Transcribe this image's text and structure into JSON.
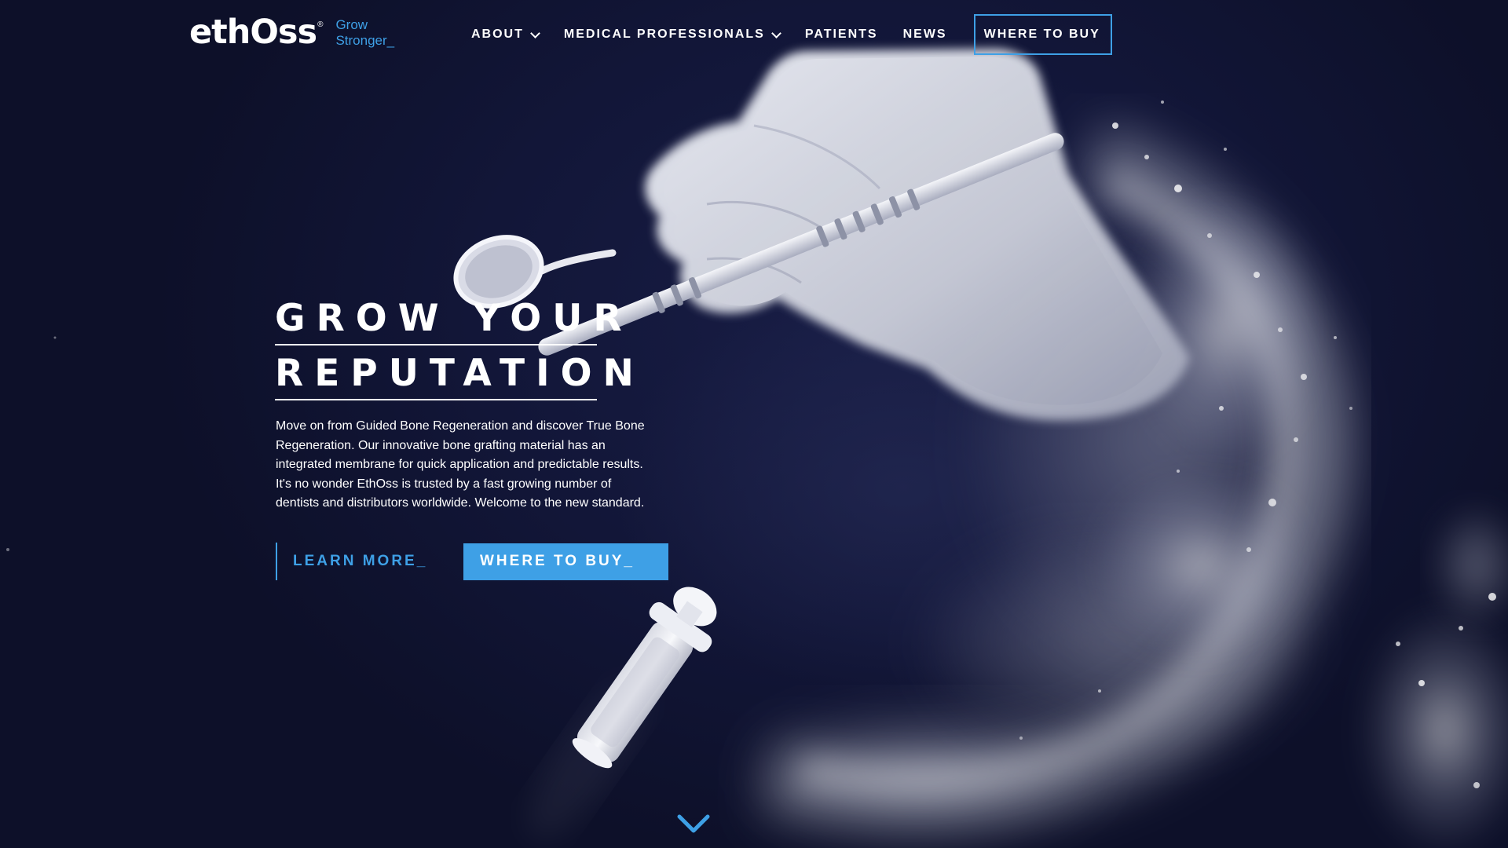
{
  "brand": {
    "name": "ethOss",
    "registered": "®",
    "tagline_line1": "Grow",
    "tagline_line2": "Stronger_"
  },
  "nav": {
    "items": [
      {
        "label": "ABOUT",
        "has_dropdown": true
      },
      {
        "label": "MEDICAL PROFESSIONALS",
        "has_dropdown": true
      },
      {
        "label": "PATIENTS",
        "has_dropdown": false
      },
      {
        "label": "NEWS",
        "has_dropdown": false
      }
    ],
    "cta_label": "WHERE TO BUY"
  },
  "hero": {
    "headline_line1": "GROW YOUR",
    "headline_line2": "REPUTATION",
    "body": "Move on from Guided Bone Regeneration and discover True Bone Regeneration. Our innovative bone grafting material has an integrated membrane for quick application and predictable results. It's no wonder EthOss is trusted by a fast growing number of dentists and distributors worldwide. Welcome to the new standard.",
    "learn_more_label": "LEARN MORE_",
    "where_to_buy_label": "WHERE TO BUY_"
  },
  "icons": {
    "dropdown": "chevron-down-icon",
    "scroll": "chevron-down-icon"
  },
  "colors": {
    "background": "#121638",
    "accent": "#3ea0e6",
    "text": "#ffffff"
  }
}
